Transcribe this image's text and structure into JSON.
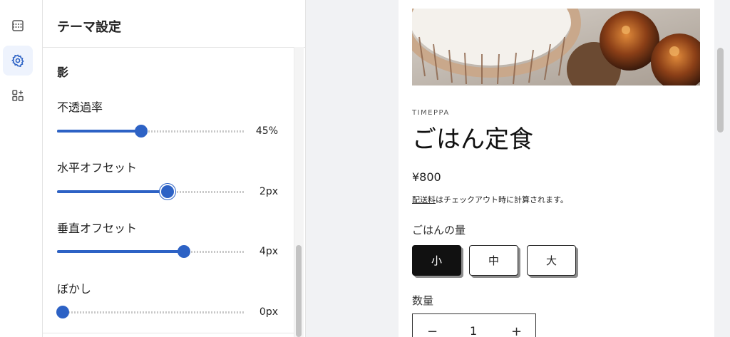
{
  "rail": {
    "items": [
      {
        "icon": "sections-icon",
        "active": false
      },
      {
        "icon": "gear-icon",
        "active": true
      },
      {
        "icon": "apps-icon",
        "active": false
      }
    ]
  },
  "panel": {
    "title": "テーマ設定",
    "section_heading": "影",
    "sliders": [
      {
        "label": "不透過率",
        "value_text": "45%",
        "fraction": 0.45
      },
      {
        "label": "水平オフセット",
        "value_text": "2px",
        "fraction": 0.59
      },
      {
        "label": "垂直オフセット",
        "value_text": "4px",
        "fraction": 0.68
      },
      {
        "label": "ぼかし",
        "value_text": "0px",
        "fraction": 0.03
      }
    ]
  },
  "product": {
    "vendor": "TIMEPPA",
    "title": "ごはん定食",
    "price": "¥800",
    "shipping_link": "配送料",
    "shipping_rest": "はチェックアウト時に計算されます。",
    "option_label": "ごはんの量",
    "sizes": [
      "小",
      "中",
      "大"
    ],
    "selected_size": "小",
    "quantity_label": "数量",
    "quantity_minus": "−",
    "quantity_value": "1",
    "quantity_plus": "+"
  },
  "colors": {
    "accent": "#2d62c5",
    "selected_button": "#111111",
    "rail_active_bg": "#eef3fd"
  }
}
